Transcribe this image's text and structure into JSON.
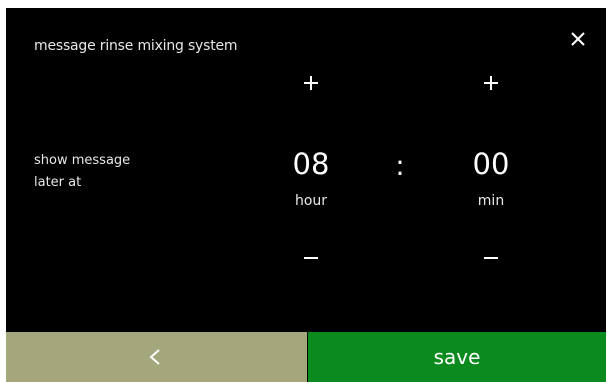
{
  "header": {
    "title": "message rinse mixing system",
    "close_icon": "close-icon"
  },
  "settings": {
    "label_line1": "show message",
    "label_line2": "later at"
  },
  "time": {
    "hour_value": "08",
    "hour_unit": "hour",
    "separator": ":",
    "minute_value": "00",
    "minute_unit": "min",
    "increment_icon": "plus-icon",
    "decrement_icon": "minus-icon"
  },
  "footer": {
    "back_icon": "chevron-left-icon",
    "save_label": "save",
    "back_color": "#a3a77b",
    "save_color": "#0b8a1d"
  }
}
